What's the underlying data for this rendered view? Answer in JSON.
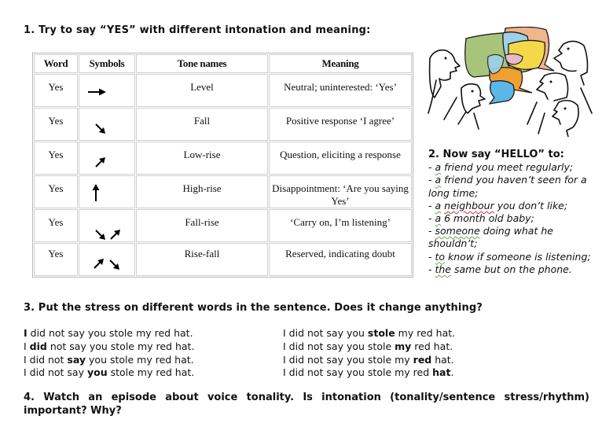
{
  "section1": {
    "title": "1. Try to say “YES” with different intonation and meaning:",
    "table": {
      "headers": [
        "Word",
        "Symbols",
        "Tone names",
        "Meaning"
      ],
      "rows": [
        {
          "word": "Yes",
          "symbol": "arrow-right",
          "tone": "Level",
          "meaning": "Neutral; uninterested: ‘Yes’"
        },
        {
          "word": "Yes",
          "symbol": "arrow-down-right",
          "tone": "Fall",
          "meaning": "Positive response ‘I agree’"
        },
        {
          "word": "Yes",
          "symbol": "arrow-up-right",
          "tone": "Low-rise",
          "meaning": "Question, eliciting a response"
        },
        {
          "word": "Yes",
          "symbol": "arrow-up",
          "tone": "High-rise",
          "meaning": "Disappointment: ‘Are you saying Yes’"
        },
        {
          "word": "Yes",
          "symbol": "arrow-down-right+arrow-up-right",
          "tone": "Fall-rise",
          "meaning": "‘Carry on, I’m listening’"
        },
        {
          "word": "Yes",
          "symbol": "arrow-up-right+arrow-down-right",
          "tone": "Rise-fall",
          "meaning": "Reserved, indicating doubt"
        }
      ]
    }
  },
  "illustration": {
    "icon": "people-talking-speech-bubbles-icon",
    "colors": [
      "#a8c47a",
      "#f2b48a",
      "#f5d84a",
      "#9fd0ea",
      "#f0a030",
      "#e9b9c7",
      "#5bb8e6"
    ]
  },
  "section2": {
    "title": "2. Now say “HELLO” to:",
    "items": [
      {
        "prefix": "- ",
        "mark": "a",
        "rest": " friend you meet regularly;"
      },
      {
        "prefix": "- ",
        "mark": "a",
        "rest": " friend you haven’t seen for a long time;"
      },
      {
        "prefix": "- ",
        "mark": "a",
        "mark2": "neighbour",
        "rest": " you don’t like;"
      },
      {
        "prefix": "- ",
        "mark": "a",
        "rest": " 6 month old baby;"
      },
      {
        "prefix": "- ",
        "mark": "someone",
        "rest": " doing what he shouldn’t;"
      },
      {
        "prefix": "- ",
        "mark": "to",
        "rest": " know if someone is listening;"
      },
      {
        "prefix": "- ",
        "mark": "the",
        "rest": " same but on the phone."
      }
    ]
  },
  "section3": {
    "title": "3. Put the stress on different words in the sentence. Does it change anything?",
    "sentences_left": [
      {
        "before": "",
        "stress": "I",
        "after": " did not say you stole my red hat."
      },
      {
        "before": "I ",
        "stress": "did",
        "after": " not say you stole my red hat."
      },
      {
        "before": "I did not ",
        "stress": "say",
        "after": " you stole my red hat."
      },
      {
        "before": "I did not say ",
        "stress": "you",
        "after": " stole my red hat."
      }
    ],
    "sentences_right": [
      {
        "before": "I did not say you ",
        "stress": "stole",
        "after": " my red hat."
      },
      {
        "before": "I did not say you stole ",
        "stress": "my",
        "after": " red hat."
      },
      {
        "before": "I did not say you stole my ",
        "stress": "red",
        "after": " hat."
      },
      {
        "before": "I did not say you stole my red ",
        "stress": "hat",
        "after": "."
      }
    ]
  },
  "section4": {
    "title": "4. Watch an episode about voice tonality. Is intonation (tonality/sentence stress/rhythm) important? Why?"
  }
}
